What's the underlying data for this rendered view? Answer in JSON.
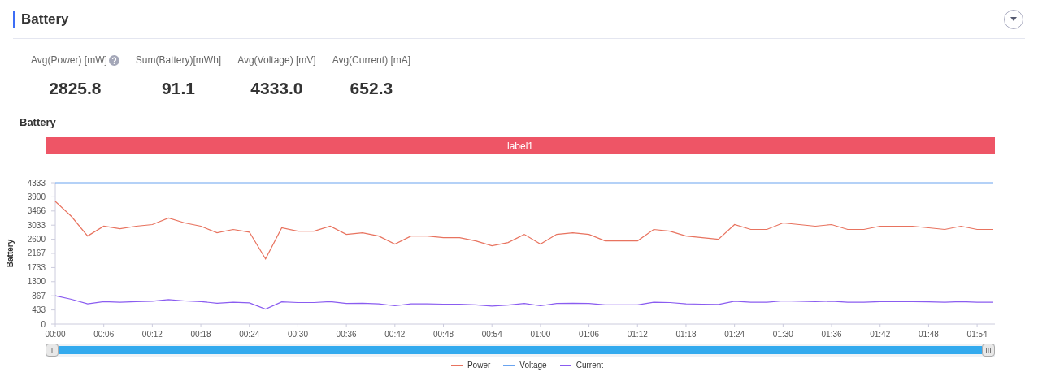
{
  "header": {
    "title": "Battery"
  },
  "stats": [
    {
      "label": "Avg(Power) [mW]",
      "value": "2825.8",
      "help": true
    },
    {
      "label": "Sum(Battery)[mWh]",
      "value": "91.1",
      "help": false
    },
    {
      "label": "Avg(Voltage) [mV]",
      "value": "4333.0",
      "help": false
    },
    {
      "label": "Avg(Current) [mA]",
      "value": "652.3",
      "help": false
    }
  ],
  "chart": {
    "title": "Battery",
    "chart_data": {
      "type": "line",
      "ylabel": "Battery",
      "x": [
        0,
        2,
        4,
        6,
        8,
        10,
        12,
        14,
        16,
        18,
        20,
        22,
        24,
        26,
        28,
        30,
        32,
        34,
        36,
        38,
        40,
        42,
        44,
        46,
        48,
        50,
        52,
        54,
        56,
        58,
        60,
        62,
        64,
        66,
        68,
        70,
        72,
        74,
        76,
        78,
        80,
        82,
        84,
        86,
        88,
        90,
        92,
        94,
        96,
        98,
        100,
        102,
        104,
        106,
        108,
        110,
        112,
        114,
        116
      ],
      "series": [
        {
          "name": "Power",
          "color": "#e8735f",
          "values": [
            3760,
            3300,
            2700,
            3000,
            2920,
            3000,
            3050,
            3250,
            3100,
            3000,
            2800,
            2900,
            2820,
            2000,
            2950,
            2850,
            2850,
            3000,
            2750,
            2800,
            2700,
            2450,
            2700,
            2700,
            2650,
            2650,
            2550,
            2400,
            2500,
            2750,
            2450,
            2750,
            2800,
            2750,
            2550,
            2550,
            2550,
            2900,
            2850,
            2700,
            2650,
            2600,
            3050,
            2900,
            2900,
            3100,
            3050,
            3000,
            3050,
            2900,
            2900,
            3000,
            3000,
            3000,
            2950,
            2900,
            3000,
            2900,
            2900
          ]
        },
        {
          "name": "Voltage",
          "color": "#6aa4f0",
          "values": [
            4333,
            4333,
            4333,
            4333,
            4333,
            4333,
            4333,
            4333,
            4333,
            4333,
            4333,
            4333,
            4333,
            4333,
            4333,
            4333,
            4333,
            4333,
            4333,
            4333,
            4333,
            4333,
            4333,
            4333,
            4333,
            4333,
            4333,
            4333,
            4333,
            4333,
            4333,
            4333,
            4333,
            4333,
            4333,
            4333,
            4333,
            4333,
            4333,
            4333,
            4333,
            4333,
            4333,
            4333,
            4333,
            4333,
            4333,
            4333,
            4333,
            4333,
            4333,
            4333,
            4333,
            4333,
            4333,
            4333,
            4333,
            4333,
            4333
          ]
        },
        {
          "name": "Current",
          "color": "#8a5cf0",
          "values": [
            870,
            760,
            620,
            690,
            670,
            690,
            700,
            750,
            710,
            690,
            640,
            670,
            650,
            460,
            680,
            660,
            660,
            690,
            630,
            640,
            620,
            560,
            620,
            620,
            610,
            610,
            590,
            550,
            580,
            630,
            560,
            630,
            640,
            630,
            590,
            590,
            590,
            670,
            660,
            620,
            610,
            600,
            700,
            670,
            670,
            710,
            700,
            690,
            700,
            670,
            670,
            690,
            690,
            690,
            680,
            670,
            690,
            670,
            670
          ]
        }
      ],
      "xlim": [
        0,
        116
      ],
      "ylim": [
        0,
        4333
      ],
      "xticks": [
        {
          "value": 0,
          "label": "00:00"
        },
        {
          "value": 6,
          "label": "00:06"
        },
        {
          "value": 12,
          "label": "00:12"
        },
        {
          "value": 18,
          "label": "00:18"
        },
        {
          "value": 24,
          "label": "00:24"
        },
        {
          "value": 30,
          "label": "00:30"
        },
        {
          "value": 36,
          "label": "00:36"
        },
        {
          "value": 42,
          "label": "00:42"
        },
        {
          "value": 48,
          "label": "00:48"
        },
        {
          "value": 54,
          "label": "00:54"
        },
        {
          "value": 60,
          "label": "01:00"
        },
        {
          "value": 66,
          "label": "01:06"
        },
        {
          "value": 72,
          "label": "01:12"
        },
        {
          "value": 78,
          "label": "01:18"
        },
        {
          "value": 84,
          "label": "01:24"
        },
        {
          "value": 90,
          "label": "01:30"
        },
        {
          "value": 96,
          "label": "01:36"
        },
        {
          "value": 102,
          "label": "01:42"
        },
        {
          "value": 108,
          "label": "01:48"
        },
        {
          "value": 114,
          "label": "01:54"
        }
      ],
      "yticks": [
        0,
        433,
        867,
        1300,
        1733,
        2167,
        2600,
        3033,
        3466,
        3900,
        4333
      ]
    },
    "band": {
      "label": "label1",
      "color": "#ee5566"
    },
    "range_slider": {
      "level": 1
    }
  }
}
